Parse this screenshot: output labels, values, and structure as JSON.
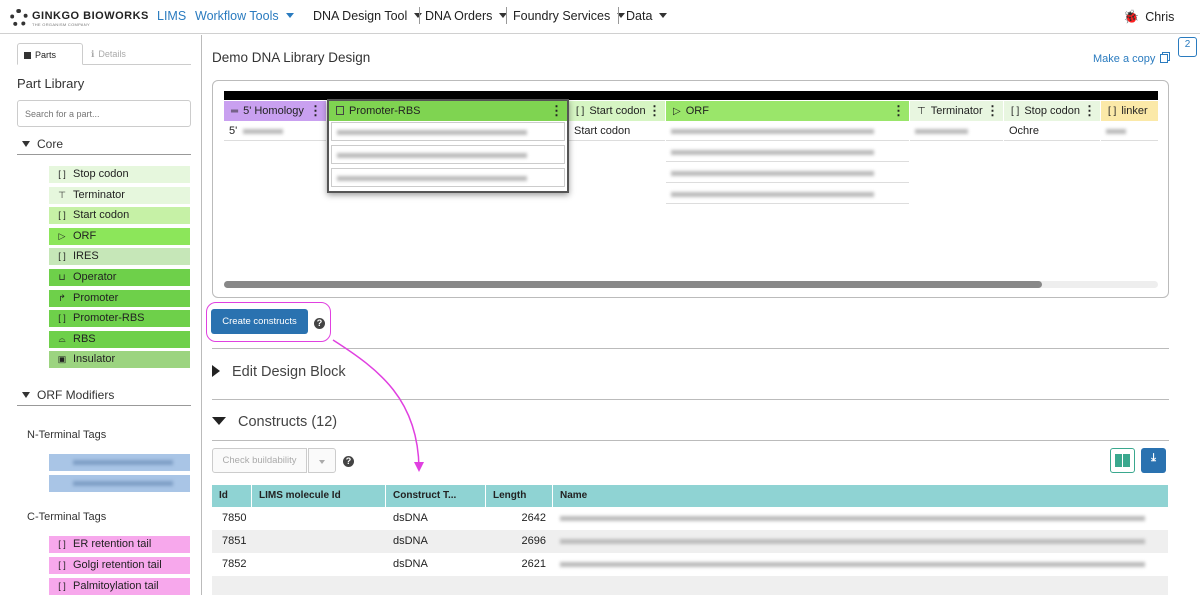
{
  "header": {
    "logo_text": "GINKGO BIOWORKS",
    "logo_sub": "THE ORGANISM COMPANY",
    "nav": [
      {
        "label": "LIMS"
      },
      {
        "label": "Workflow Tools"
      },
      {
        "label": "DNA Design Tool"
      },
      {
        "label": "DNA Orders"
      },
      {
        "label": "Foundry Services"
      },
      {
        "label": "Data"
      }
    ],
    "user": "Chris"
  },
  "sidebar": {
    "tab_parts": "Parts",
    "tab_details": "Details",
    "title": "Part Library",
    "search_placeholder": "Search for a part...",
    "core_label": "Core",
    "core_parts": [
      {
        "label": "Stop codon",
        "color": "#e6f7dd"
      },
      {
        "label": "Terminator",
        "color": "#e6f7dd"
      },
      {
        "label": "Start codon",
        "color": "#c6f1a6"
      },
      {
        "label": "ORF",
        "color": "#8ce65a"
      },
      {
        "label": "IRES",
        "color": "#c6e7b8"
      },
      {
        "label": "Operator",
        "color": "#6ed04a"
      },
      {
        "label": "Promoter",
        "color": "#6ed04a"
      },
      {
        "label": "Promoter-RBS",
        "color": "#6ed04a"
      },
      {
        "label": "RBS",
        "color": "#6ed04a"
      },
      {
        "label": "Insulator",
        "color": "#9cd480"
      }
    ],
    "orf_label": "ORF Modifiers",
    "n_terminal_label": "N-Terminal Tags",
    "c_terminal_label": "C-Terminal Tags",
    "c_terminal_parts": [
      {
        "label": "ER retention tail",
        "color": "#f7a8ec"
      },
      {
        "label": "Golgi retention tail",
        "color": "#f7a8ec"
      },
      {
        "label": "Palmitoylation tail",
        "color": "#f7a8ec"
      }
    ]
  },
  "main": {
    "title": "Demo DNA Library Design",
    "make_copy": "Make a copy",
    "badge_count": "2",
    "columns": [
      {
        "label": "5' Homology",
        "color": "#c9a0f0",
        "first_cell": "5'"
      },
      {
        "label": "Promoter-RBS",
        "color": "#7fd451",
        "first_cell": ""
      },
      {
        "label": "Start codon",
        "color": "#d6f5c3",
        "first_cell": "Start codon"
      },
      {
        "label": "ORF",
        "color": "#9ae66a",
        "first_cell": ""
      },
      {
        "label": "Terminator",
        "color": "#e8f6e0",
        "first_cell": ""
      },
      {
        "label": "Stop codon",
        "color": "#e8f6e0",
        "first_cell": "Ochre"
      },
      {
        "label": "linker",
        "color": "#fbe9a8",
        "first_cell": ""
      }
    ],
    "create_constructs": "Create constructs",
    "edit_design_block": "Edit Design Block",
    "constructs_label": "Constructs (12)",
    "check_buildability": "Check buildability",
    "table": {
      "headers": [
        "Id",
        "LIMS molecule Id",
        "Construct T...",
        "Length",
        "Name"
      ],
      "rows": [
        {
          "id": "7850",
          "lims": "",
          "type": "dsDNA",
          "length": "2642"
        },
        {
          "id": "7851",
          "lims": "",
          "type": "dsDNA",
          "length": "2696"
        },
        {
          "id": "7852",
          "lims": "",
          "type": "dsDNA",
          "length": "2621"
        }
      ]
    },
    "colors": {
      "accent": "#2a72b0",
      "highlight": "#e040e0",
      "table_head": "#8fd3d3"
    }
  }
}
